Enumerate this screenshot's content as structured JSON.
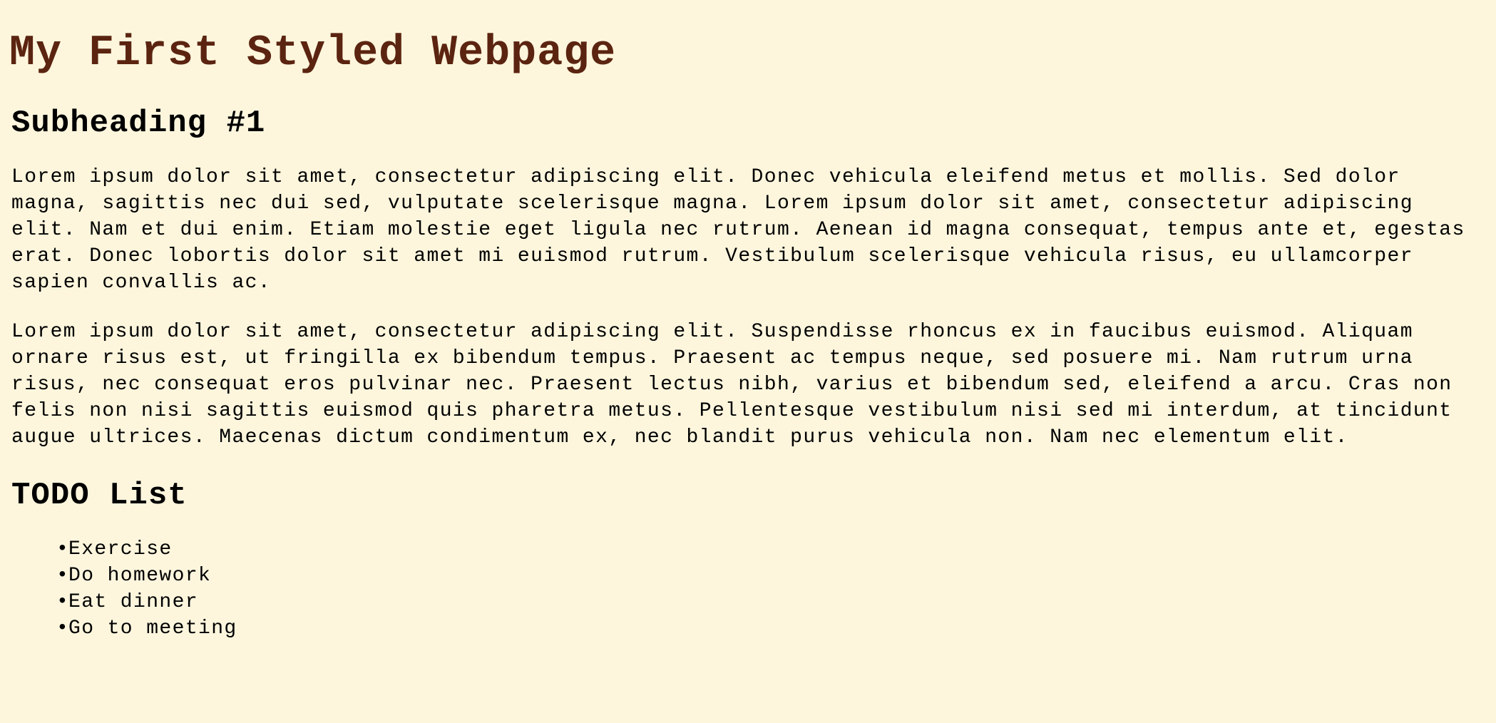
{
  "page": {
    "title": "My First Styled Webpage",
    "subheading": "Subheading #1",
    "paragraphs": [
      "Lorem ipsum dolor sit amet, consectetur adipiscing elit. Donec vehicula eleifend metus et mollis. Sed dolor magna, sagittis nec dui sed, vulputate scelerisque magna. Lorem ipsum dolor sit amet, consectetur adipiscing elit. Nam et dui enim. Etiam molestie eget ligula nec rutrum. Aenean id magna consequat, tempus ante et, egestas erat. Donec lobortis dolor sit amet mi euismod rutrum. Vestibulum scelerisque vehicula risus, eu ullamcorper sapien convallis ac.",
      "Lorem ipsum dolor sit amet, consectetur adipiscing elit. Suspendisse rhoncus ex in faucibus euismod. Aliquam ornare risus est, ut fringilla ex bibendum tempus. Praesent ac tempus neque, sed posuere mi. Nam rutrum urna risus, nec consequat eros pulvinar nec. Praesent lectus nibh, varius et bibendum sed, eleifend a arcu. Cras non felis non nisi sagittis euismod quis pharetra metus. Pellentesque vestibulum nisi sed mi interdum, at tincidunt augue ultrices. Maecenas dictum condimentum ex, nec blandit purus vehicula non. Nam nec elementum elit."
    ],
    "todo_heading": "TODO List",
    "todo_items": [
      "Exercise",
      "Do homework",
      "Eat dinner",
      "Go to meeting"
    ]
  },
  "colors": {
    "background": "#fdf6dd",
    "title": "#5b2410",
    "text": "#000000"
  }
}
